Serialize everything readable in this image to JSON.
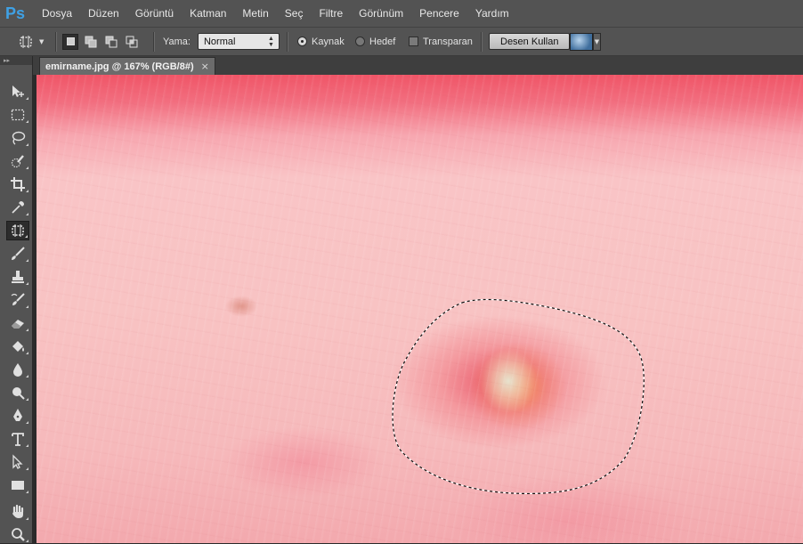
{
  "app": {
    "logo": "Ps",
    "accent": "#3fa1e5"
  },
  "menu": [
    "Dosya",
    "Düzen",
    "Görüntü",
    "Katman",
    "Metin",
    "Seç",
    "Filtre",
    "Görünüm",
    "Pencere",
    "Yardım"
  ],
  "options": {
    "tool_preset_icon": "patch-tool-icon",
    "selection_modes": [
      "new-selection-icon",
      "add-to-selection-icon",
      "subtract-from-selection-icon",
      "intersect-selection-icon"
    ],
    "patch_label": "Yama:",
    "patch_value": "Normal",
    "source_label": "Kaynak",
    "destination_label": "Hedef",
    "transparent_label": "Transparan",
    "use_pattern_label": "Desen Kullan",
    "source_selected": true,
    "transparent_checked": false
  },
  "document": {
    "tab_title": "emirname.jpg @ 167% (RGB/8#)",
    "close_glyph": "×"
  },
  "tools": [
    "move-tool-icon",
    "marquee-tool-icon",
    "lasso-tool-icon",
    "quick-selection-tool-icon",
    "crop-tool-icon",
    "eyedropper-tool-icon",
    "patch-tool-icon",
    "brush-tool-icon",
    "clone-stamp-tool-icon",
    "history-brush-tool-icon",
    "eraser-tool-icon",
    "paint-bucket-tool-icon",
    "blur-tool-icon",
    "dodge-tool-icon",
    "pen-tool-icon",
    "type-tool-icon",
    "path-selection-tool-icon",
    "rectangle-tool-icon",
    "hand-tool-icon",
    "zoom-tool-icon"
  ],
  "active_tool": "patch-tool-icon"
}
